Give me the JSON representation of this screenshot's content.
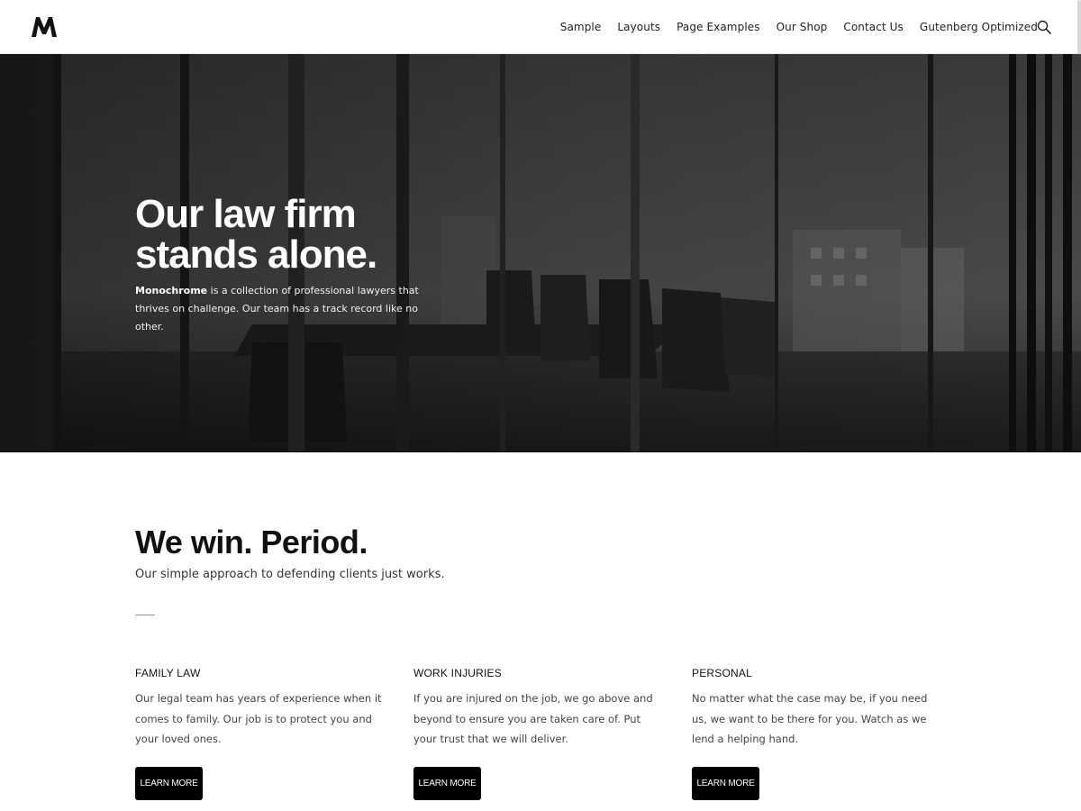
{
  "header": {
    "logo_text": "M",
    "nav": [
      "Sample",
      "Layouts",
      "Page Examples",
      "Our Shop",
      "Contact Us",
      "Gutenberg Optimized"
    ],
    "search_icon": "search-icon"
  },
  "hero": {
    "title_line1": "Our law firm",
    "title_line2": "stands alone.",
    "brand": "Monochrome",
    "text": " is a collection of professional lawyers that thrives on challenge. Our team has a track record like no other."
  },
  "intro": {
    "title": "We win. Period.",
    "subtitle": "Our simple approach to defending clients just works."
  },
  "services": [
    {
      "title": "FAMILY LAW",
      "text": "Our legal team has years of experience when it comes to family. Our job is to protect you and your loved ones.",
      "button": "LEARN MORE"
    },
    {
      "title": "WORK INJURIES",
      "text": "If you are injured on the job, we go above and beyond to ensure you are taken care of. Put your trust that we will deliver.",
      "button": "LEARN MORE"
    },
    {
      "title": "PERSONAL",
      "text": "No matter what the case may be, if you need us, we want to be there for you. Watch as we lend a helping hand.",
      "button": "LEARN MORE"
    }
  ]
}
